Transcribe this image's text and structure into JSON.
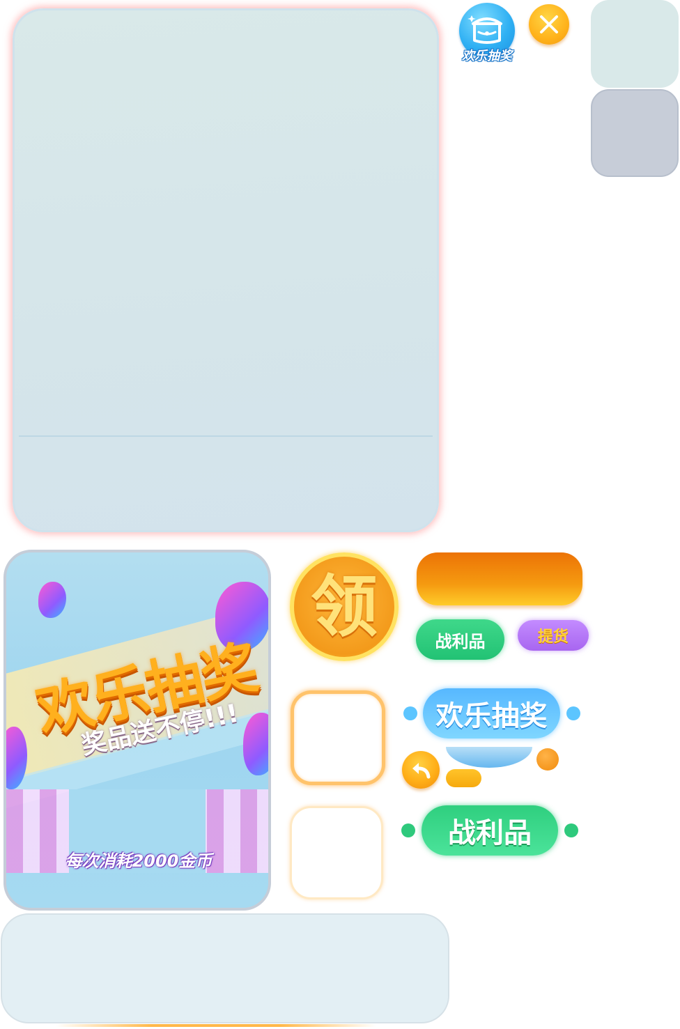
{
  "badges": {
    "lottery_label": "欢乐抽奖"
  },
  "promo": {
    "title": "欢乐抽奖",
    "subtitle": "奖品送不停!!!",
    "cost_text": "每次消耗2000金币"
  },
  "claim": {
    "coin_label": "领"
  },
  "pills": {
    "spoils": "战利品",
    "pickup": "提货",
    "lottery_title": "欢乐抽奖",
    "spoils_title": "战利品"
  },
  "icons": {
    "lottery": "treasure-chest-icon",
    "close": "close-icon",
    "back": "back-arrow-icon"
  },
  "colors": {
    "accent_orange": "#f59a10",
    "accent_green": "#2ec97c",
    "accent_blue": "#57b8ff",
    "accent_purple": "#a866f0",
    "panel_bg": "#d7e7ea"
  }
}
